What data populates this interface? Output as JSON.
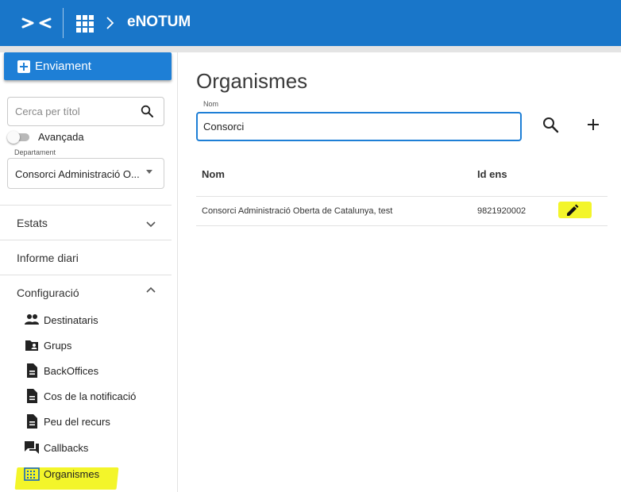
{
  "header": {
    "app_title": "eNOTUM",
    "logo_icon": "app-logo-icon",
    "apps_icon": "apps-grid-icon",
    "separator_icon": "chevron-right-icon",
    "brand_color": "#1976c9"
  },
  "sidebar": {
    "new_button_label": "Enviament",
    "search": {
      "placeholder": "Cerca per títol",
      "value": ""
    },
    "advanced_toggle": {
      "label": "Avançada",
      "on": false
    },
    "department": {
      "label": "Departament",
      "value": "Consorci Administració O..."
    },
    "nav": [
      {
        "label": "Estats",
        "expanded": false
      },
      {
        "label": "Informe diari"
      },
      {
        "label": "Configuració",
        "expanded": true
      }
    ],
    "config_items": [
      {
        "label": "Destinataris",
        "icon": "people-icon"
      },
      {
        "label": "Grups",
        "icon": "folder-shared-icon"
      },
      {
        "label": "BackOffices",
        "icon": "document-icon"
      },
      {
        "label": "Cos de la notificació",
        "icon": "document-icon"
      },
      {
        "label": "Peu del recurs",
        "icon": "document-icon"
      },
      {
        "label": "Callbacks",
        "icon": "forum-icon"
      },
      {
        "label": "Organismes",
        "icon": "domain-icon",
        "active": true
      }
    ]
  },
  "main": {
    "title": "Organismes",
    "filter": {
      "label": "Nom",
      "value": "Consorci"
    },
    "search_icon": "search-icon",
    "add_icon": "plus-icon",
    "table": {
      "columns": [
        "Nom",
        "Id ens"
      ],
      "rows": [
        {
          "nom": "Consorci Administració Oberta de Catalunya, test",
          "id_ens": "9821920002",
          "action_icon": "edit-icon"
        }
      ]
    }
  },
  "highlight_color": "#f3f52a"
}
